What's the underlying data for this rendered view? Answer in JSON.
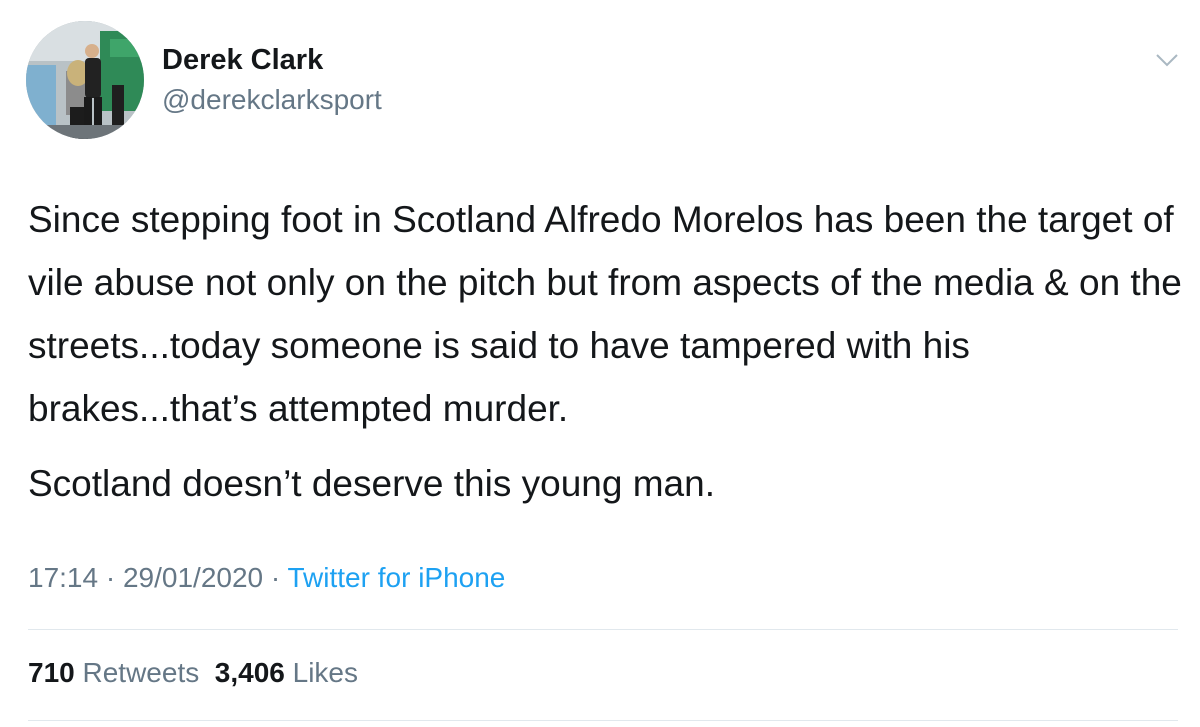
{
  "author": {
    "display_name": "Derek Clark",
    "handle": "@derekclarksport"
  },
  "tweet": {
    "paragraphs": [
      "Since stepping foot in Scotland Alfredo Morelos has been the target of  vile abuse not only on the pitch but from aspects of the media & on the streets...today someone is said to have tampered with his brakes...that’s attempted murder.",
      "Scotland doesn’t deserve this young man."
    ]
  },
  "meta": {
    "time": "17:14",
    "separator": " · ",
    "date": "29/01/2020",
    "source": "Twitter for iPhone"
  },
  "stats": {
    "retweets_count": "710",
    "retweets_label": "Retweets",
    "likes_count": "3,406",
    "likes_label": "Likes"
  },
  "icons": {
    "menu": "chevron-down-icon"
  },
  "colors": {
    "text": "#14171a",
    "secondary": "#657786",
    "link": "#1da1f2",
    "divider": "#e1e8ed"
  }
}
